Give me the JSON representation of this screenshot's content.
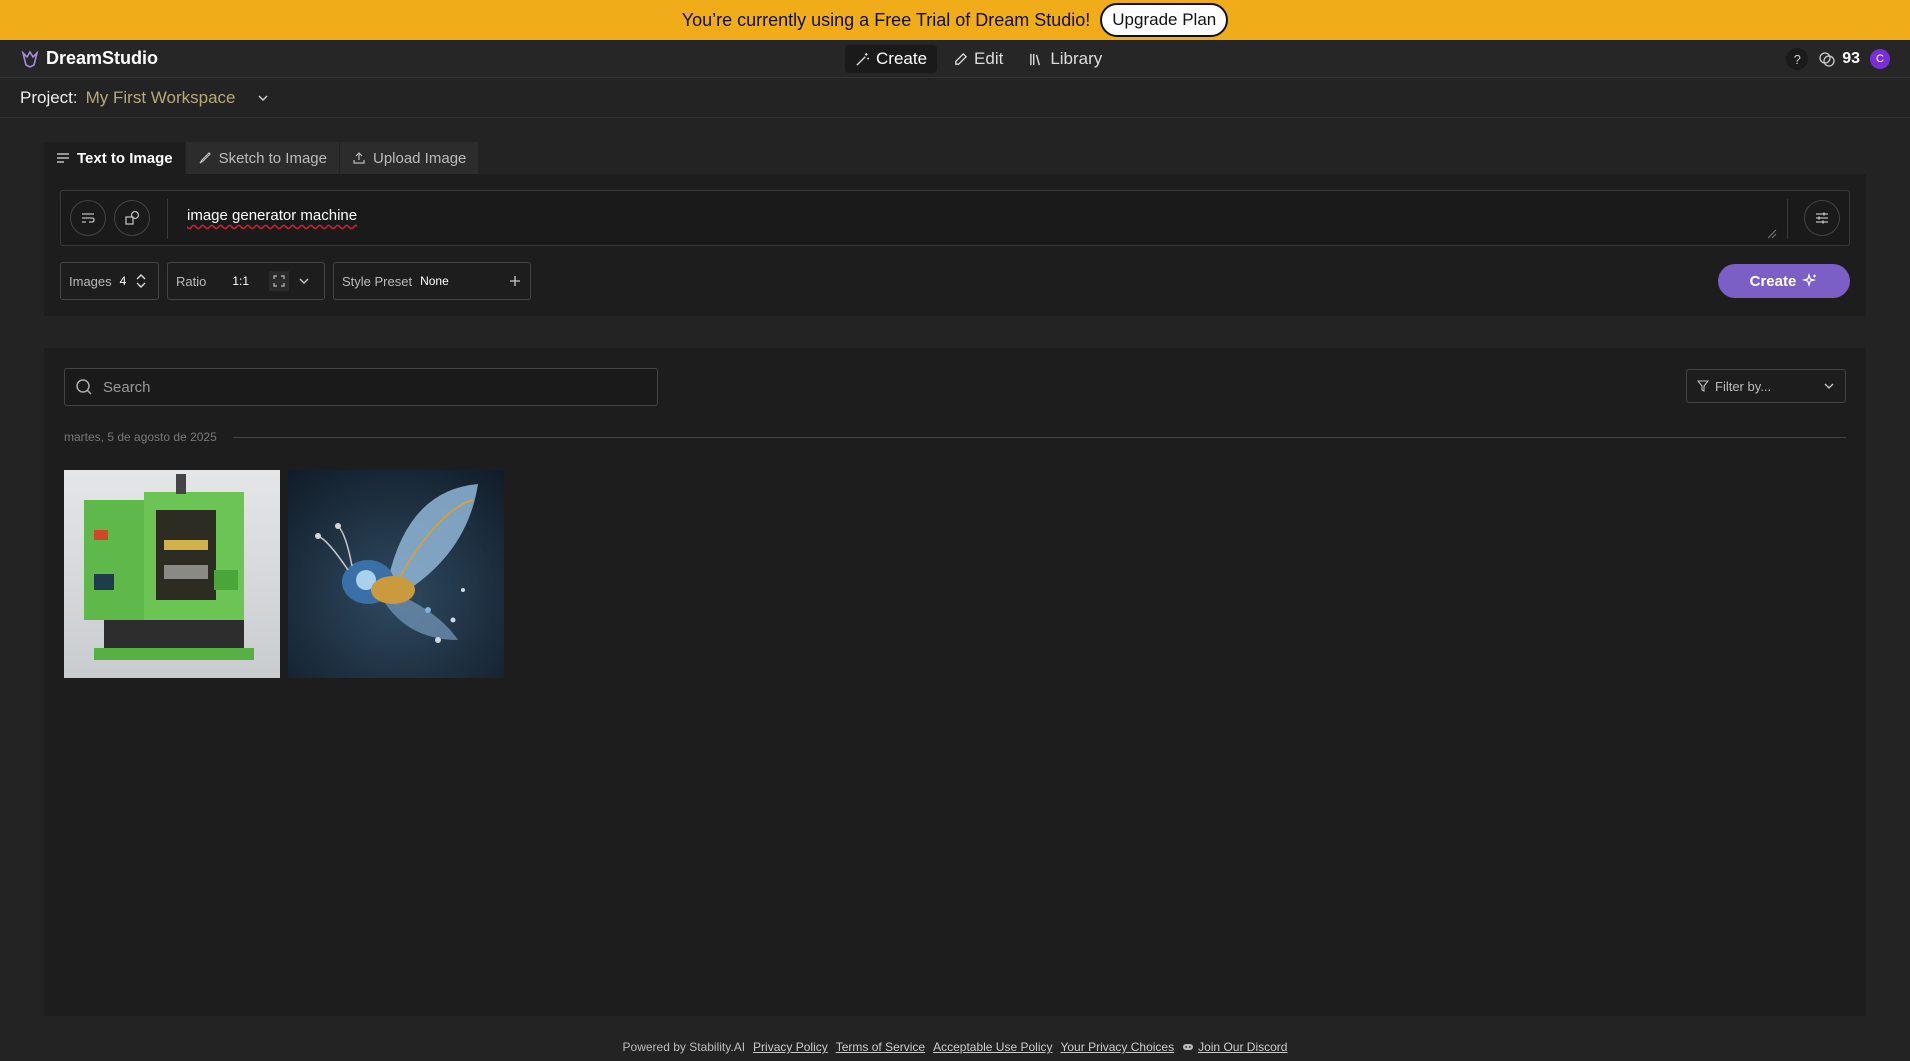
{
  "banner": {
    "message": "You’re currently using a Free Trial of Dream Studio!",
    "upgrade_label": "Upgrade Plan"
  },
  "header": {
    "brand": "DreamStudio",
    "tabs": [
      {
        "label": "Create",
        "icon": "wand-icon",
        "active": true
      },
      {
        "label": "Edit",
        "icon": "pencil-icon",
        "active": false
      },
      {
        "label": "Library",
        "icon": "library-icon",
        "active": false
      }
    ],
    "help_label": "?",
    "credits": "93",
    "avatar_initial": "C"
  },
  "project": {
    "label": "Project:",
    "name": "My First Workspace"
  },
  "mode_tabs": [
    {
      "label": "Text to Image",
      "icon": "lines-icon",
      "active": true
    },
    {
      "label": "Sketch to Image",
      "icon": "brush-icon",
      "active": false
    },
    {
      "label": "Upload Image",
      "icon": "upload-icon",
      "active": false
    }
  ],
  "prompt": {
    "text": "image generator machine"
  },
  "controls": {
    "images_label": "Images",
    "images_value": "4",
    "ratio_label": "Ratio",
    "ratio_value": "1:1",
    "style_label": "Style Preset",
    "style_value": "None",
    "create_label": "Create"
  },
  "gallery": {
    "search_placeholder": "Search",
    "filter_label": "Filter by...",
    "date_heading": "martes, 5 de agosto de 2025",
    "images": [
      {
        "subject": "green industrial machine"
      },
      {
        "subject": "jeweled mechanical butterfly"
      }
    ]
  },
  "footer": {
    "powered": "Powered by Stability.AI",
    "links": [
      "Privacy Policy",
      "Terms of Service",
      "Acceptable Use Policy",
      "Your Privacy Choices",
      "Join Our Discord"
    ]
  },
  "colors": {
    "banner": "#f0ad19",
    "accent": "#7b5fc4",
    "background": "#232323"
  }
}
